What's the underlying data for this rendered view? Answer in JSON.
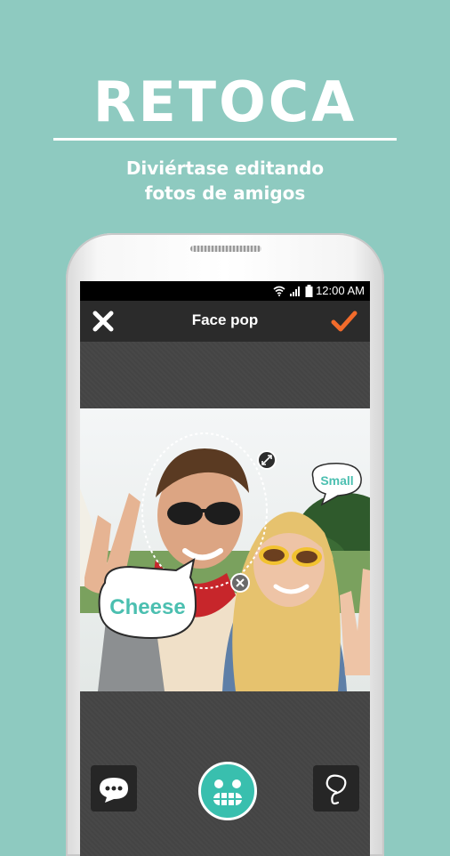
{
  "promo": {
    "headline": "RETOCA",
    "subtitle_line1": "Diviértase editando",
    "subtitle_line2": "fotos de amigos"
  },
  "status_bar": {
    "time": "12:00 AM",
    "icons": [
      "wifi-icon",
      "signal-icon",
      "battery-icon"
    ]
  },
  "app_bar": {
    "title": "Face pop",
    "close_icon": "close-icon",
    "confirm_icon": "checkmark-icon"
  },
  "stickers": {
    "cheese": "Cheese",
    "small": "Small"
  },
  "toolbar": {
    "left_icon": "speech-bubble-icon",
    "center_icon": "face-sticker-icon",
    "right_icon": "lasso-icon"
  },
  "colors": {
    "background": "#8ecac0",
    "accent": "#39bfae",
    "confirm": "#f26b2b"
  }
}
